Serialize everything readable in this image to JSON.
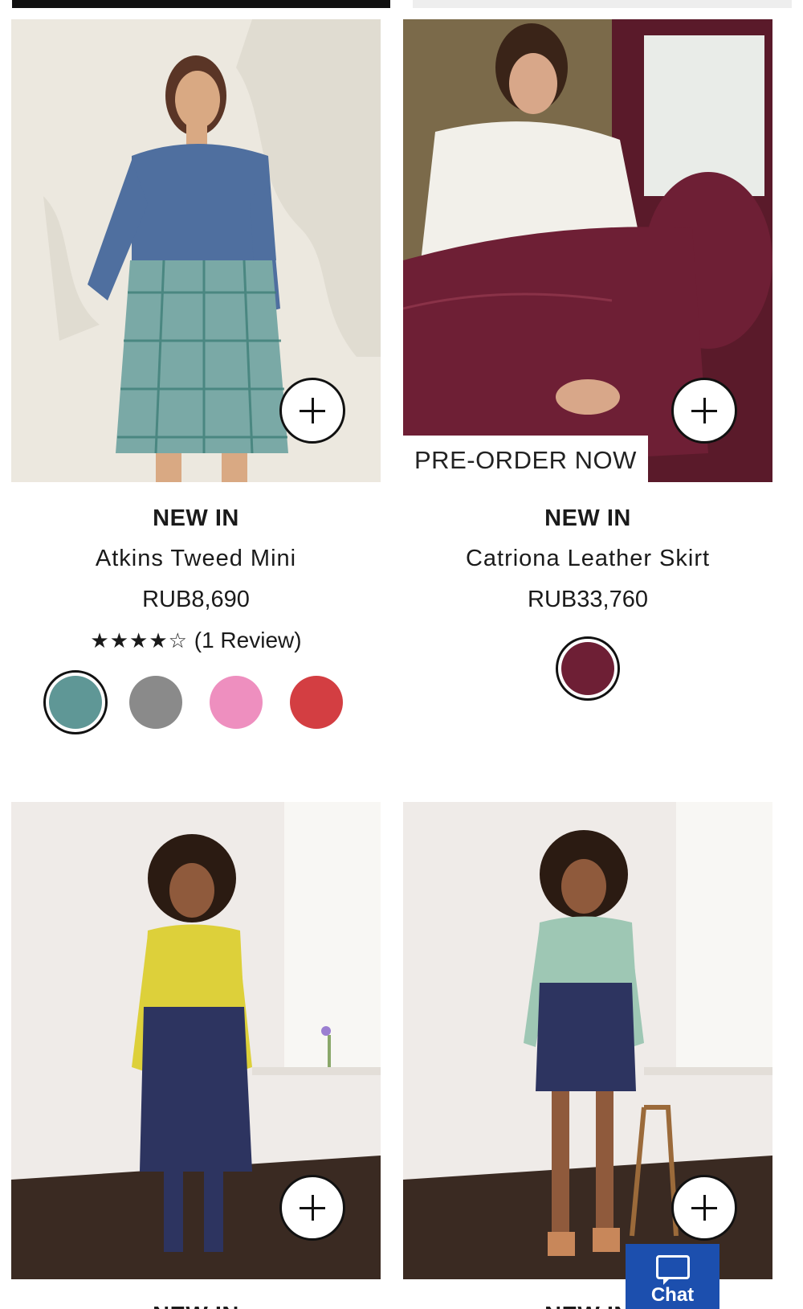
{
  "products": [
    {
      "tag": "NEW IN",
      "name": "Atkins Tweed Mini",
      "price": "RUB8,690",
      "rating": {
        "stars": 4,
        "max": 5,
        "stars_text": "★★★★☆",
        "reviews_text": "(1 Review)"
      },
      "swatches": [
        {
          "color": "#5f9796",
          "selected": true
        },
        {
          "color": "#8a8a8a",
          "selected": false
        },
        {
          "color": "#ee8fbf",
          "selected": false
        },
        {
          "color": "#d33e42",
          "selected": false
        }
      ],
      "colors": {
        "background": "#ece8df",
        "top": "#4f6f9f",
        "skirt": "#7aa9a6",
        "skin": "#d9a983",
        "hair": "#5a3526"
      }
    },
    {
      "tag": "NEW IN",
      "name": "Catriona Leather Skirt",
      "price": "RUB33,760",
      "badge": "PRE-ORDER NOW",
      "swatches": [
        {
          "color": "#6e1f35",
          "selected": true
        }
      ],
      "colors": {
        "background": "#7b6a4a",
        "top": "#f2f0ea",
        "skirt": "#6e1f35",
        "skin": "#d8a789",
        "hair": "#3a2418"
      }
    },
    {
      "tag": "NEW IN",
      "colors": {
        "background": "#efebe8",
        "top": "#ddd03a",
        "skirt": "#2d3460",
        "skin": "#8f5a3c",
        "hair": "#2b1b12",
        "floor": "#3a2a22"
      }
    },
    {
      "tag": "NEW IN",
      "colors": {
        "background": "#efebe8",
        "top": "#9ec7b4",
        "skirt": "#2d3460",
        "skin": "#8f5a3c",
        "hair": "#2b1b12",
        "floor": "#3a2a22"
      }
    }
  ],
  "chat": {
    "label": "Chat",
    "color": "#1c4fae"
  }
}
